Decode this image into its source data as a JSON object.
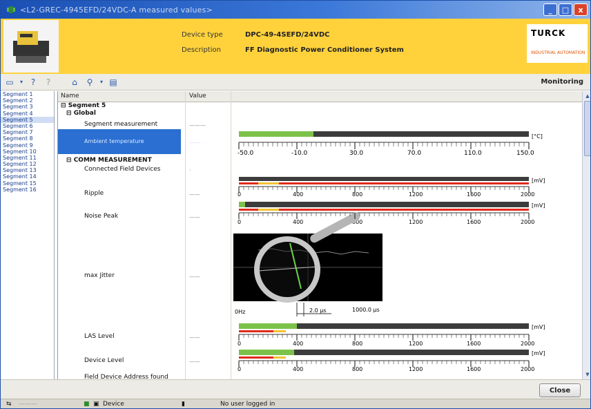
{
  "window": {
    "title": "<L2-GREC-4945EFD/24VDC-A measured values>",
    "controls": {
      "minimize": "_",
      "maximize": "□",
      "close": "x"
    }
  },
  "header": {
    "device_type_label": "Device type",
    "device_type_value": "DPC-49-4SEFD/24VDC",
    "description_label": "Description",
    "description_value": "FF Diagnostic Power Conditioner System",
    "logo_brand": "TURCK",
    "logo_sub": "INDUSTRIAL AUTOMATION"
  },
  "toolbar": {
    "mode": "Monitoring"
  },
  "segments": {
    "items": [
      "Segment 1",
      "Segment 2",
      "Segment 3",
      "Segment 4",
      "Segment 5",
      "Segment 6",
      "Segment 7",
      "Segment 8",
      "Segment 9",
      "Segment 10",
      "Segment 11",
      "Segment 12",
      "Segment 13",
      "Segment 14",
      "Segment 15",
      "Segment 16"
    ],
    "selected_index": 4
  },
  "tree": {
    "col_name": "Name",
    "col_value": "Value",
    "segment": "Segment 5",
    "global": "Global",
    "segment_measurement": "Segment measurement",
    "ambient_temperature": "Ambient temperature",
    "comm_measurement": "COMM MEASUREMENT",
    "connected_field_devices": "Connected Field Devices",
    "ripple": "Ripple",
    "noise_peak": "Noise Peak",
    "max_jitter": "max Jitter",
    "las_level": "LAS Level",
    "device_level": "Device Level",
    "field_device_address": "Field Device Address found"
  },
  "gauges": {
    "temperature": {
      "unit": "[°C]",
      "ticks": [
        "-50.0",
        "-10.0",
        "30.0",
        "70.0",
        "110.0",
        "150.0"
      ],
      "min": -50,
      "max": 150,
      "value": 0,
      "green_fraction": 0.26
    },
    "ripple": {
      "unit": "[mV]",
      "ticks": [
        "0",
        "400",
        "800",
        "1200",
        "1600",
        "2000"
      ],
      "min": 0,
      "max": 2000
    },
    "noise_peak": {
      "unit": "[mV]",
      "ticks": [
        "0",
        "400",
        "800",
        "1200",
        "1600",
        "2000"
      ],
      "min": 0,
      "max": 2000,
      "green_fraction": 0.02
    },
    "jitter": {
      "label_left": "0Hz",
      "label_right": "1000.0 µs",
      "marker": "2.0 µs"
    },
    "las_level": {
      "unit": "[mV]",
      "ticks": [
        "0",
        "400",
        "800",
        "1200",
        "1600",
        "2000"
      ],
      "min": 0,
      "max": 2000,
      "green_fraction": 0.2
    },
    "device_level": {
      "unit": "[mV]",
      "ticks": [
        "0",
        "400",
        "800",
        "1200",
        "1600",
        "2000"
      ],
      "min": 0,
      "max": 2000,
      "green_fraction": 0.19
    }
  },
  "bottom": {
    "close": "Close"
  },
  "status": {
    "device": "Device",
    "user": "No user logged in"
  },
  "colors": {
    "titlebar": "#1a4fb3",
    "header": "#ffd23c",
    "selection": "#2a6fd1",
    "gauge_green": "#7cc24a",
    "gauge_track": "#3c3c3c",
    "alarm_red": "#e02a1a",
    "warn_yellow": "#f1c232"
  }
}
